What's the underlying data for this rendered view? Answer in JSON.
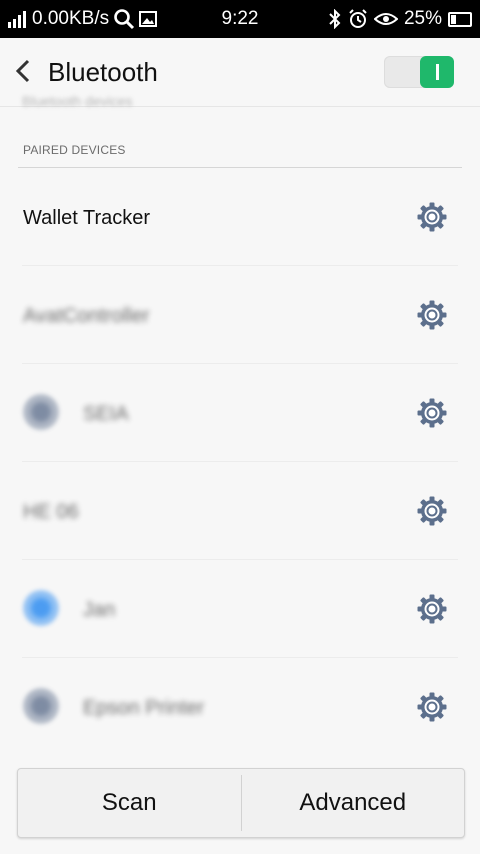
{
  "status_bar": {
    "data_speed": "0.00KB/s",
    "time": "9:22",
    "battery": "25%",
    "icons": [
      "signal-icon",
      "search-icon",
      "image-icon",
      "bluetooth-icon",
      "alarm-icon",
      "eye-icon",
      "battery-icon"
    ],
    "battery_level": 0.25
  },
  "header": {
    "title": "Bluetooth",
    "back_icon": "chevron-left-icon",
    "toggle_on": true
  },
  "hidden_section_label": "Bluetooth devices",
  "paired_section_label": "PAIRED DEVICES",
  "devices": [
    {
      "name": "Wallet Tracker",
      "blurred": false,
      "icon": null
    },
    {
      "name": "AvatController",
      "blurred": true,
      "icon": null
    },
    {
      "name": "SEIA",
      "blurred": true,
      "icon": "device-icon",
      "icon_color": "#6a7a95"
    },
    {
      "name": "HE 06",
      "blurred": true,
      "icon": null
    },
    {
      "name": "Jan",
      "blurred": true,
      "icon": "device-icon",
      "icon_color": "#2f8df0"
    },
    {
      "name": "Epson Printer",
      "blurred": true,
      "icon": "device-icon",
      "icon_color": "#6a7a95"
    }
  ],
  "buttons": {
    "scan": "Scan",
    "advanced": "Advanced"
  },
  "colors": {
    "toggle_on": "#1fb86b",
    "gear": "#5c6f8c"
  }
}
